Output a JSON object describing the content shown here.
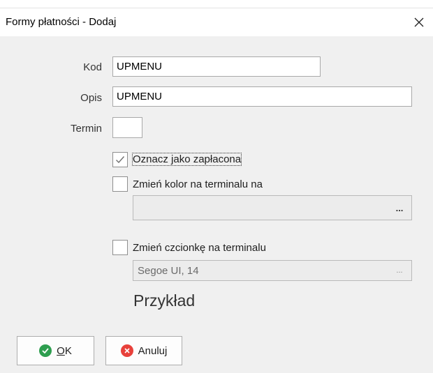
{
  "window": {
    "title": "Formy płatności - Dodaj",
    "close_icon": "close-icon"
  },
  "form": {
    "kod_label": "Kod",
    "kod_value": "UPMENU",
    "opis_label": "Opis",
    "opis_value": "UPMENU",
    "termin_label": "Termin",
    "termin_value": ""
  },
  "options": {
    "paid_label": "Oznacz jako zapłacona",
    "paid_checked": true,
    "color_label": "Zmień kolor na terminalu na",
    "color_checked": false,
    "color_value": "",
    "color_picker_button": "...",
    "font_label": "Zmień czcionkę na terminalu",
    "font_checked": false,
    "font_value": "Segoe UI, 14",
    "font_picker_button": "...",
    "example_text": "Przykład"
  },
  "buttons": {
    "ok_mnemonic": "O",
    "ok_rest": "K",
    "ok_icon": "check-circle-icon",
    "ok_color": "#2e9e4f",
    "cancel_label": "Anuluj",
    "cancel_icon": "x-circle-icon",
    "cancel_color": "#e8413b"
  }
}
